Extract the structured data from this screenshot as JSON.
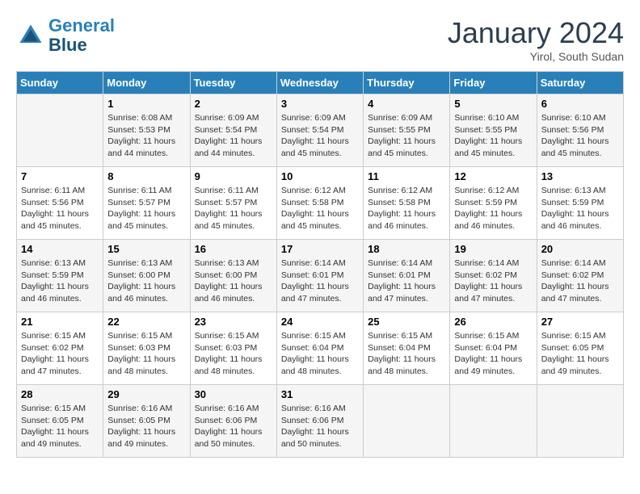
{
  "header": {
    "logo_line1": "General",
    "logo_line2": "Blue",
    "month": "January 2024",
    "location": "Yirol, South Sudan"
  },
  "weekdays": [
    "Sunday",
    "Monday",
    "Tuesday",
    "Wednesday",
    "Thursday",
    "Friday",
    "Saturday"
  ],
  "weeks": [
    [
      {
        "day": "",
        "info": ""
      },
      {
        "day": "1",
        "info": "Sunrise: 6:08 AM\nSunset: 5:53 PM\nDaylight: 11 hours\nand 44 minutes."
      },
      {
        "day": "2",
        "info": "Sunrise: 6:09 AM\nSunset: 5:54 PM\nDaylight: 11 hours\nand 44 minutes."
      },
      {
        "day": "3",
        "info": "Sunrise: 6:09 AM\nSunset: 5:54 PM\nDaylight: 11 hours\nand 45 minutes."
      },
      {
        "day": "4",
        "info": "Sunrise: 6:09 AM\nSunset: 5:55 PM\nDaylight: 11 hours\nand 45 minutes."
      },
      {
        "day": "5",
        "info": "Sunrise: 6:10 AM\nSunset: 5:55 PM\nDaylight: 11 hours\nand 45 minutes."
      },
      {
        "day": "6",
        "info": "Sunrise: 6:10 AM\nSunset: 5:56 PM\nDaylight: 11 hours\nand 45 minutes."
      }
    ],
    [
      {
        "day": "7",
        "info": "Sunrise: 6:11 AM\nSunset: 5:56 PM\nDaylight: 11 hours\nand 45 minutes."
      },
      {
        "day": "8",
        "info": "Sunrise: 6:11 AM\nSunset: 5:57 PM\nDaylight: 11 hours\nand 45 minutes."
      },
      {
        "day": "9",
        "info": "Sunrise: 6:11 AM\nSunset: 5:57 PM\nDaylight: 11 hours\nand 45 minutes."
      },
      {
        "day": "10",
        "info": "Sunrise: 6:12 AM\nSunset: 5:58 PM\nDaylight: 11 hours\nand 45 minutes."
      },
      {
        "day": "11",
        "info": "Sunrise: 6:12 AM\nSunset: 5:58 PM\nDaylight: 11 hours\nand 46 minutes."
      },
      {
        "day": "12",
        "info": "Sunrise: 6:12 AM\nSunset: 5:59 PM\nDaylight: 11 hours\nand 46 minutes."
      },
      {
        "day": "13",
        "info": "Sunrise: 6:13 AM\nSunset: 5:59 PM\nDaylight: 11 hours\nand 46 minutes."
      }
    ],
    [
      {
        "day": "14",
        "info": "Sunrise: 6:13 AM\nSunset: 5:59 PM\nDaylight: 11 hours\nand 46 minutes."
      },
      {
        "day": "15",
        "info": "Sunrise: 6:13 AM\nSunset: 6:00 PM\nDaylight: 11 hours\nand 46 minutes."
      },
      {
        "day": "16",
        "info": "Sunrise: 6:13 AM\nSunset: 6:00 PM\nDaylight: 11 hours\nand 46 minutes."
      },
      {
        "day": "17",
        "info": "Sunrise: 6:14 AM\nSunset: 6:01 PM\nDaylight: 11 hours\nand 47 minutes."
      },
      {
        "day": "18",
        "info": "Sunrise: 6:14 AM\nSunset: 6:01 PM\nDaylight: 11 hours\nand 47 minutes."
      },
      {
        "day": "19",
        "info": "Sunrise: 6:14 AM\nSunset: 6:02 PM\nDaylight: 11 hours\nand 47 minutes."
      },
      {
        "day": "20",
        "info": "Sunrise: 6:14 AM\nSunset: 6:02 PM\nDaylight: 11 hours\nand 47 minutes."
      }
    ],
    [
      {
        "day": "21",
        "info": "Sunrise: 6:15 AM\nSunset: 6:02 PM\nDaylight: 11 hours\nand 47 minutes."
      },
      {
        "day": "22",
        "info": "Sunrise: 6:15 AM\nSunset: 6:03 PM\nDaylight: 11 hours\nand 48 minutes."
      },
      {
        "day": "23",
        "info": "Sunrise: 6:15 AM\nSunset: 6:03 PM\nDaylight: 11 hours\nand 48 minutes."
      },
      {
        "day": "24",
        "info": "Sunrise: 6:15 AM\nSunset: 6:04 PM\nDaylight: 11 hours\nand 48 minutes."
      },
      {
        "day": "25",
        "info": "Sunrise: 6:15 AM\nSunset: 6:04 PM\nDaylight: 11 hours\nand 48 minutes."
      },
      {
        "day": "26",
        "info": "Sunrise: 6:15 AM\nSunset: 6:04 PM\nDaylight: 11 hours\nand 49 minutes."
      },
      {
        "day": "27",
        "info": "Sunrise: 6:15 AM\nSunset: 6:05 PM\nDaylight: 11 hours\nand 49 minutes."
      }
    ],
    [
      {
        "day": "28",
        "info": "Sunrise: 6:15 AM\nSunset: 6:05 PM\nDaylight: 11 hours\nand 49 minutes."
      },
      {
        "day": "29",
        "info": "Sunrise: 6:16 AM\nSunset: 6:05 PM\nDaylight: 11 hours\nand 49 minutes."
      },
      {
        "day": "30",
        "info": "Sunrise: 6:16 AM\nSunset: 6:06 PM\nDaylight: 11 hours\nand 50 minutes."
      },
      {
        "day": "31",
        "info": "Sunrise: 6:16 AM\nSunset: 6:06 PM\nDaylight: 11 hours\nand 50 minutes."
      },
      {
        "day": "",
        "info": ""
      },
      {
        "day": "",
        "info": ""
      },
      {
        "day": "",
        "info": ""
      }
    ]
  ]
}
